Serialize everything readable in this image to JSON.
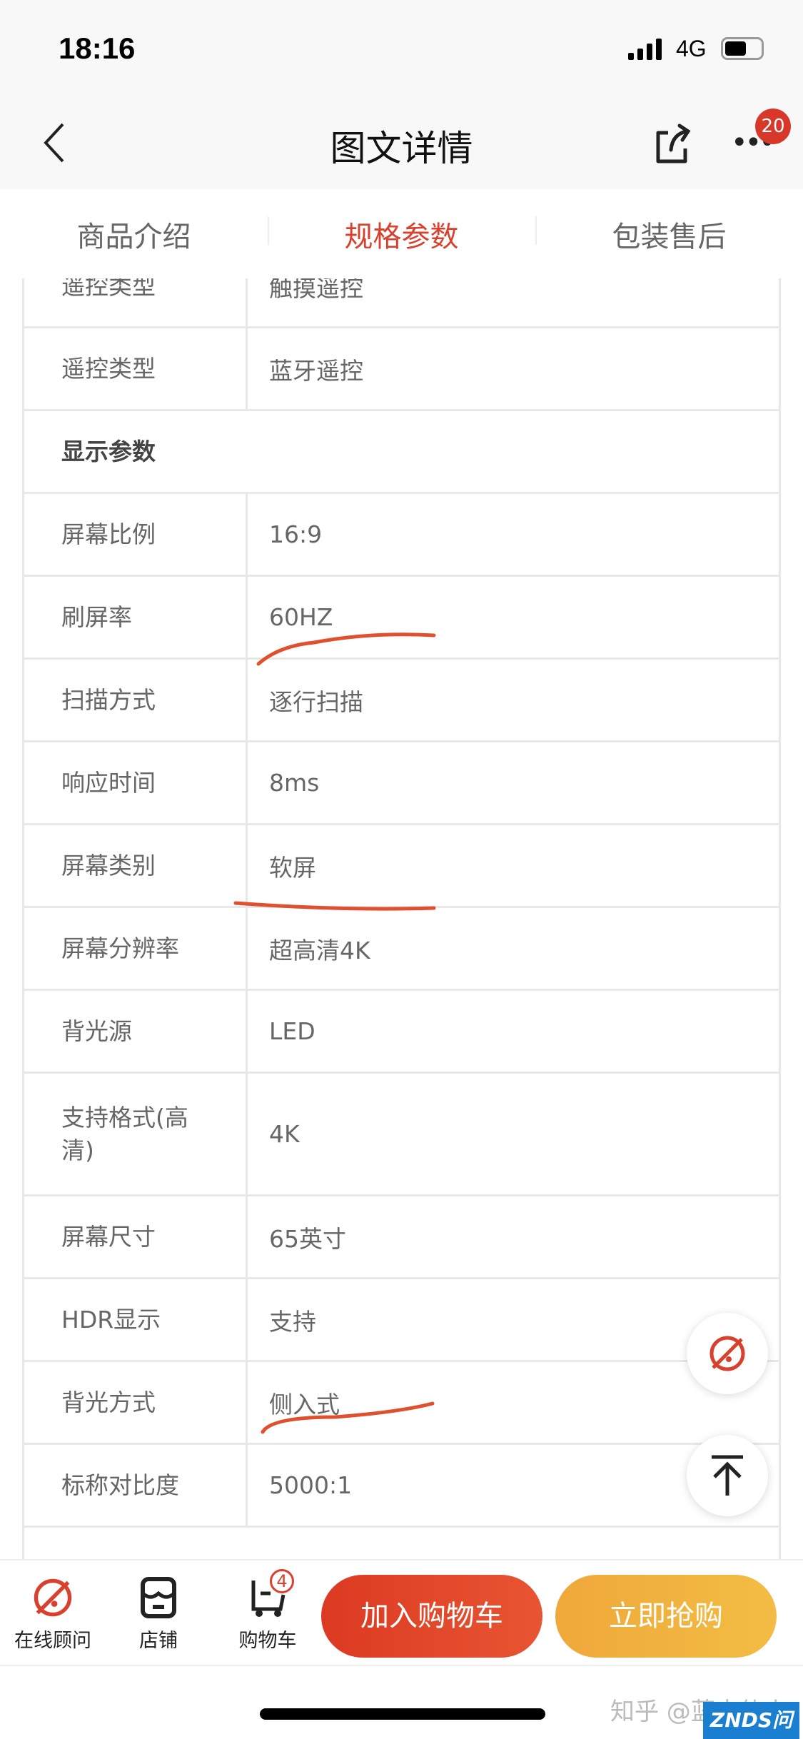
{
  "status_bar": {
    "time": "18:16",
    "network": "4G",
    "battery_level": 0.6
  },
  "nav": {
    "title": "图文详情",
    "more_badge": "20"
  },
  "tabs": [
    {
      "label": "商品介绍",
      "active": false
    },
    {
      "label": "规格参数",
      "active": true
    },
    {
      "label": "包装售后",
      "active": false
    }
  ],
  "specs": [
    {
      "label": "遥控类型",
      "value": "触摸遥控"
    },
    {
      "label": "遥控类型",
      "value": "蓝牙遥控"
    },
    {
      "section": "显示参数"
    },
    {
      "label": "屏幕比例",
      "value": "16:9"
    },
    {
      "label": "刷屏率",
      "value": "60HZ"
    },
    {
      "label": "扫描方式",
      "value": "逐行扫描"
    },
    {
      "label": "响应时间",
      "value": "8ms"
    },
    {
      "label": "屏幕类别",
      "value": "软屏"
    },
    {
      "label": "屏幕分辨率",
      "value": "超高清4K"
    },
    {
      "label": "背光源",
      "value": "LED"
    },
    {
      "label": "支持格式(高清)",
      "value": "4K"
    },
    {
      "label": "屏幕尺寸",
      "value": "65英寸"
    },
    {
      "label": "HDR显示",
      "value": "支持"
    },
    {
      "label": "背光方式",
      "value": "侧入式"
    },
    {
      "label": "标称对比度",
      "value": "5000:1"
    }
  ],
  "bottom_bar": {
    "consult": "在线顾问",
    "shop": "店铺",
    "cart": "购物车",
    "cart_badge": "4",
    "add_to_cart": "加入购物车",
    "buy_now": "立即抢购"
  },
  "colors": {
    "accent": "#d8412d",
    "buy_now": "#f0b43c",
    "annotation": "#e0502e"
  },
  "watermark": {
    "zhihu": "知乎 @蓝大仙人",
    "znds": "ZNDS问答"
  }
}
